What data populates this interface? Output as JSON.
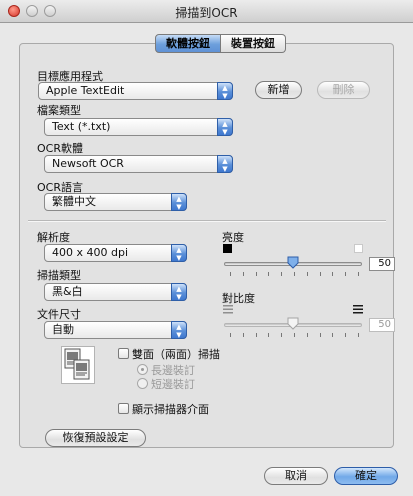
{
  "window": {
    "title": "掃描到OCR"
  },
  "tabs": [
    {
      "label": "軟體按鈕",
      "selected": true
    },
    {
      "label": "裝置按鈕",
      "selected": false
    }
  ],
  "target_app": {
    "label": "目標應用程式",
    "value": "Apple TextEdit",
    "add_button": "新增",
    "delete_button": "刪除"
  },
  "file_type": {
    "label": "檔案類型",
    "value": "Text (*.txt)"
  },
  "ocr_software": {
    "label": "OCR軟體",
    "value": "Newsoft OCR"
  },
  "ocr_language": {
    "label": "OCR語言",
    "value": "繁體中文"
  },
  "resolution": {
    "label": "解析度",
    "value": "400 x 400 dpi"
  },
  "scan_type": {
    "label": "掃描類型",
    "value": "黑&白"
  },
  "document_size": {
    "label": "文件尺寸",
    "value": "自動"
  },
  "brightness": {
    "label": "亮度",
    "value": "50",
    "level_percent": 50
  },
  "contrast": {
    "label": "對比度",
    "value": "50",
    "level_percent": 50,
    "enabled": false
  },
  "duplex": {
    "label": "雙面（兩面）掃描",
    "checked": false,
    "options": [
      {
        "label": "長邊裝訂",
        "selected": true
      },
      {
        "label": "短邊裝訂",
        "selected": false
      }
    ]
  },
  "show_scanner_interface": {
    "label": "顯示掃描器介面",
    "checked": false
  },
  "restore_defaults_button": "恢復預設設定",
  "cancel_button": "取消",
  "ok_button": "確定",
  "colors": {
    "accent": "#5f92d6",
    "close": "#d6352a"
  }
}
